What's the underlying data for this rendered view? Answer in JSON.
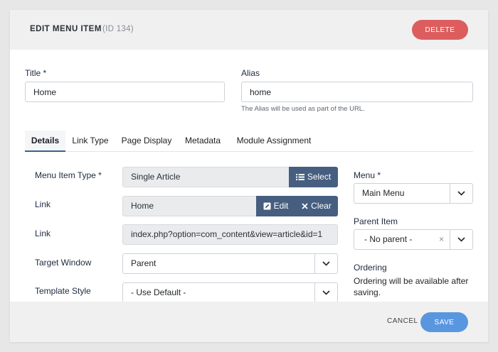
{
  "header": {
    "title": "EDIT MENU ITEM",
    "id_text": "(ID 134)",
    "delete_label": "DELETE"
  },
  "title_field": {
    "label": "Title *",
    "value": "Home"
  },
  "alias_field": {
    "label": "Alias",
    "value": "home",
    "hint": "The Alias will be used as part of the URL."
  },
  "tabs": [
    {
      "label": "Details",
      "active": true
    },
    {
      "label": "Link Type",
      "active": false
    },
    {
      "label": "Page Display",
      "active": false
    },
    {
      "label": "Metadata",
      "active": false
    },
    {
      "label": "Module Assignment",
      "active": false
    }
  ],
  "details": {
    "menu_item_type": {
      "label": "Menu Item Type *",
      "value": "Single Article",
      "select_label": "Select",
      "select_icon": "list-icon"
    },
    "link_article": {
      "label": "Link",
      "value": "Home",
      "edit_label": "Edit",
      "edit_icon": "edit-icon",
      "clear_label": "Clear",
      "clear_icon": "close-icon"
    },
    "link_url": {
      "label": "Link",
      "value": "index.php?option=com_content&view=article&id=1"
    },
    "target_window": {
      "label": "Target Window",
      "value": "Parent"
    },
    "template_style": {
      "label": "Template Style",
      "value": "- Use Default -"
    }
  },
  "sidebar": {
    "menu": {
      "label": "Menu *",
      "value": "Main Menu"
    },
    "parent_item": {
      "label": "Parent Item",
      "value": "- No parent -",
      "clear_glyph": "×"
    },
    "ordering": {
      "label": "Ordering",
      "text": "Ordering will be available after saving."
    }
  },
  "footer": {
    "cancel_label": "CANCEL",
    "save_label": "SAVE"
  },
  "colors": {
    "delete": "#dd5d5f",
    "save": "#5897e0",
    "button_blue": "#465e7f",
    "header_bg": "#f0f0f0"
  }
}
